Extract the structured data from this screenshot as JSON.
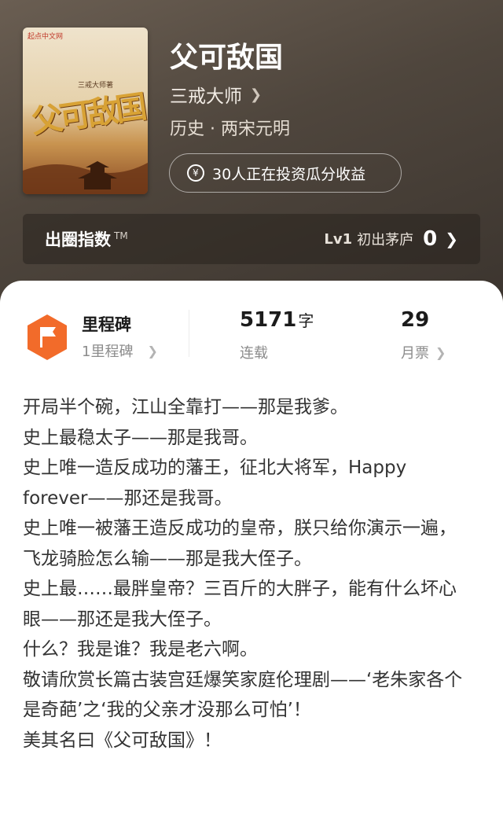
{
  "book": {
    "title": "父可敌国",
    "author": "三戒大师",
    "genre": "历史 · 两宋元明",
    "cover": {
      "publisher_tag": "起点中文网",
      "author_tag": "三戒大师著",
      "title_art": "父可敌国"
    }
  },
  "invest": {
    "icon": "yen-icon",
    "label": "30人正在投资瓜分收益"
  },
  "index_bar": {
    "label": "出圈指数",
    "tm": "TM",
    "level": "Lv1",
    "level_name": "初出茅庐",
    "score": "0"
  },
  "stats": {
    "milestone": {
      "icon": "flag-icon",
      "label": "里程碑",
      "sub": "1里程碑"
    },
    "words": {
      "value": "5171",
      "unit": "字",
      "status": "连载"
    },
    "monthly_votes": {
      "value": "29",
      "label": "月票"
    }
  },
  "description": [
    "开局半个碗，江山全靠打——那是我爹。",
    "史上最稳太子——那是我哥。",
    "史上唯一造反成功的藩王，征北大将军，Happy forever——那还是我哥。",
    "史上唯一被藩王造反成功的皇帝，朕只给你演示一遍，飞龙骑脸怎么输——那是我大侄子。",
    "史上最……最胖皇帝？三百斤的大胖子，能有什么坏心眼——那还是我大侄子。",
    "什么？我是谁？我是老六啊。",
    "敬请欣赏长篇古装宫廷爆笑家庭伦理剧——‘老朱家各个是奇葩’之‘我的父亲才没那么可怕’！",
    "美其名曰《父可敌国》！"
  ],
  "colors": {
    "header_bg": "#4f463d",
    "card_bg": "#ffffff",
    "milestone_orange": "#f26b2a",
    "text_dark": "#1b1b1b",
    "text_muted": "#8c8c8c"
  }
}
